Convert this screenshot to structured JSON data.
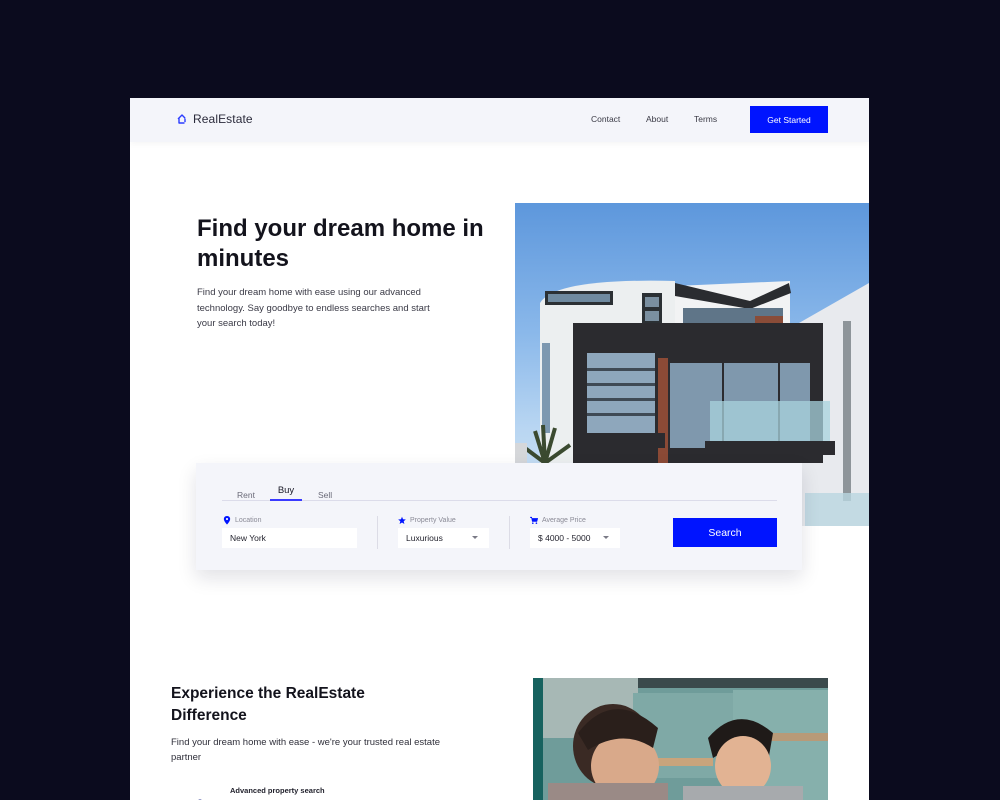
{
  "header": {
    "brand": "RealEstate",
    "brand_icon": "house-outline-icon",
    "nav": [
      {
        "label": "Contact"
      },
      {
        "label": "About"
      },
      {
        "label": "Terms"
      }
    ],
    "cta_label": "Get Started"
  },
  "hero": {
    "title": "Find your dream home in minutes",
    "description": "Find your dream home with ease using our advanced technology. Say goodbye to endless searches and start your search today!",
    "image_alt": "Modern multi-story house with dark trim and glass balconies"
  },
  "search": {
    "tabs": [
      {
        "label": "Rent",
        "active": false
      },
      {
        "label": "Buy",
        "active": true
      },
      {
        "label": "Sell",
        "active": false
      }
    ],
    "location": {
      "label": "Location",
      "icon": "map-pin-icon",
      "value": "New York"
    },
    "property_value": {
      "label": "Property Value",
      "icon": "star-icon",
      "selected": "Luxurious"
    },
    "average_price": {
      "label": "Average Price",
      "icon": "cart-icon",
      "selected": "$ 4000 - 5000"
    },
    "button_label": "Search"
  },
  "section2": {
    "title": "Experience the RealEstate Difference",
    "description": "Find your dream home with ease - we're your trusted real estate partner",
    "features": [
      {
        "label": "Advanced property search"
      }
    ],
    "image_alt": "Two people looking at documents together"
  },
  "colors": {
    "accent": "#0014ff",
    "page_bg": "#0b0b1e",
    "header_bg": "#f4f5fa",
    "card_bg": "#f4f5fa"
  }
}
